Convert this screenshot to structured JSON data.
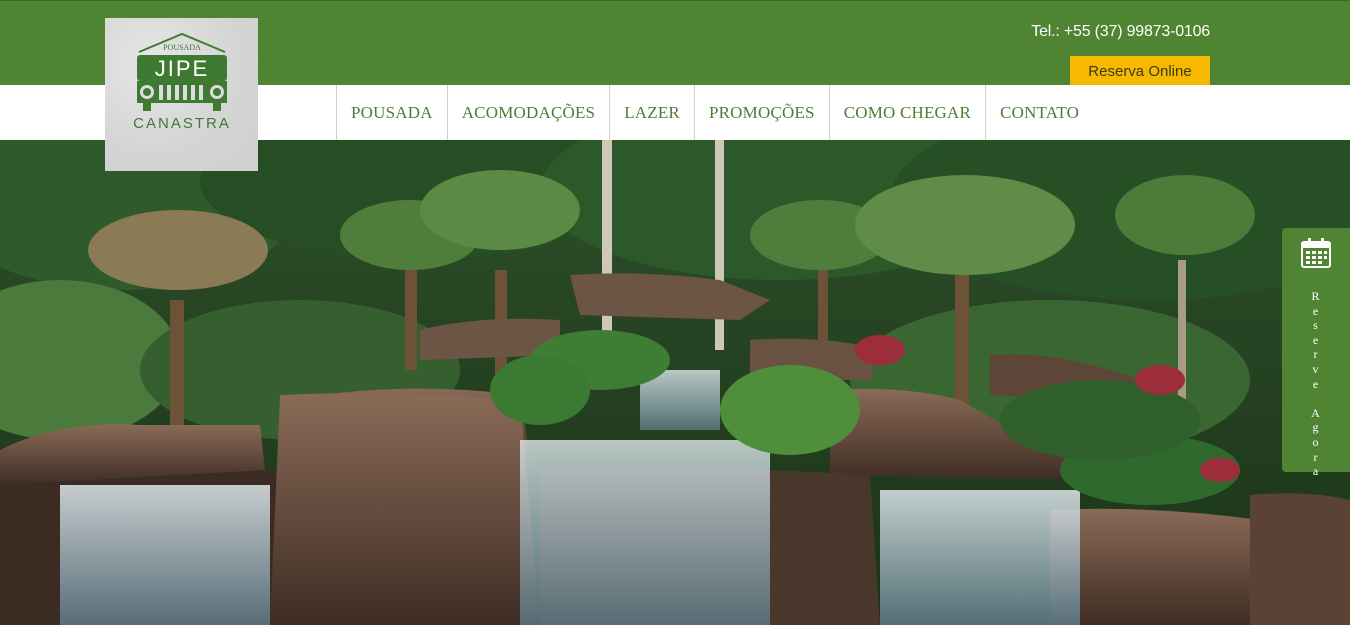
{
  "header": {
    "phone": "Tel.: +55 (37) 99873-0106",
    "reserve_button": "Reserva Online"
  },
  "logo": {
    "top_text": "POUSADA",
    "main_text": "JIPE",
    "bottom_text": "CANASTRA",
    "icon": "jeep-grille-icon"
  },
  "nav": {
    "items": [
      "POUSADA",
      "ACOMODAÇÕES",
      "LAZER",
      "PROMOÇÕES",
      "COMO CHEGAR",
      "CONTATO"
    ]
  },
  "side_tab": {
    "icon": "calendar-icon",
    "label": "Reserve Agora"
  },
  "colors": {
    "brand_green": "#4f8433",
    "button_yellow": "#f7b800",
    "nav_text": "#4b7e34"
  }
}
